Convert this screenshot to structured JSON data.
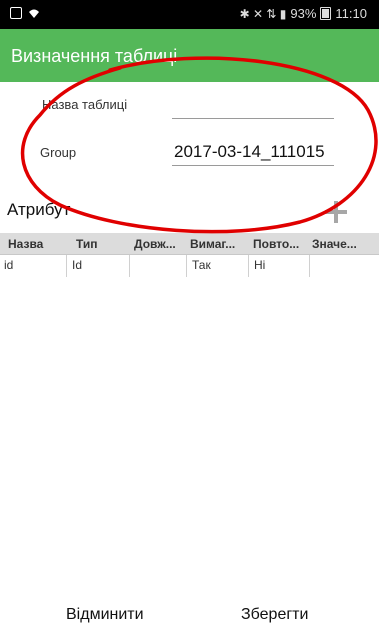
{
  "status_bar": {
    "left_icons": [
      "screenshot-icon",
      "wifi-icon"
    ],
    "right_glyphs": "✱ ✕ ⇅ ▮",
    "battery_percent": "93%",
    "time": "11:10"
  },
  "app_bar": {
    "title": "Визначення таблиці"
  },
  "form": {
    "table_name_label": "Назва таблиці",
    "table_name_value": "",
    "group_label": "Group",
    "group_value": "2017-03-14_111015"
  },
  "attributes": {
    "title": "Атрибут",
    "columns": [
      "Назва",
      "Тип",
      "Довж...",
      "Вимаг...",
      "Повто...",
      "Значе..."
    ],
    "rows": [
      [
        "id",
        "Id",
        "",
        "Так",
        "Ні",
        ""
      ]
    ]
  },
  "buttons": {
    "cancel": "Відминити",
    "save": "Зберегти"
  },
  "colors": {
    "accent": "#54b859",
    "annotation": "#e00000"
  }
}
